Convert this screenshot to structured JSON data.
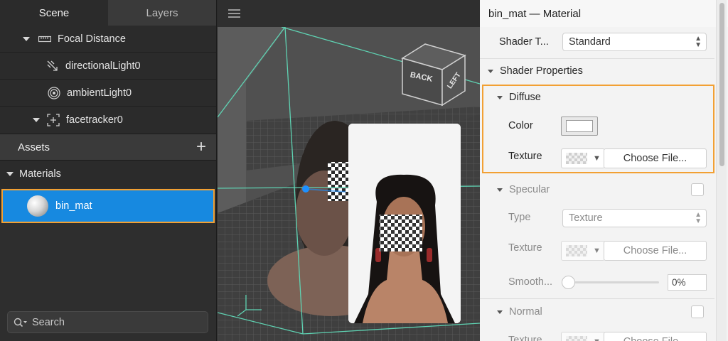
{
  "left_panel": {
    "tabs": [
      {
        "label": "Scene",
        "active": true
      },
      {
        "label": "Layers",
        "active": false
      }
    ],
    "scene_tree": [
      {
        "label": "Focal Distance",
        "icon": "ruler-icon",
        "expanded": true
      },
      {
        "label": "directionalLight0",
        "icon": "directional-light-icon"
      },
      {
        "label": "ambientLight0",
        "icon": "ambient-light-icon"
      },
      {
        "label": "facetracker0",
        "icon": "facetracker-icon",
        "expanded": true
      }
    ],
    "assets": {
      "title": "Assets",
      "add_icon": "plus-icon",
      "group_label": "Materials",
      "selected_item": "bin_mat"
    },
    "search": {
      "placeholder": "Search"
    }
  },
  "viewport": {
    "cube_faces": [
      "BACK",
      "LEFT"
    ],
    "colors": {
      "grid_line": "#5fd3b3",
      "tracker_dot": "#1e90ff"
    }
  },
  "inspector": {
    "title": "bin_mat — Material",
    "shader_type": {
      "label": "Shader T...",
      "value": "Standard"
    },
    "shader_properties": {
      "label": "Shader Properties"
    },
    "diffuse": {
      "label": "Diffuse",
      "color_label": "Color",
      "color_value": "#ffffff",
      "texture_label": "Texture",
      "choose_file": "Choose File..."
    },
    "specular": {
      "label": "Specular",
      "type_label": "Type",
      "type_value": "Texture",
      "texture_label": "Texture",
      "choose_file": "Choose File...",
      "smoothness_label": "Smooth...",
      "smoothness_value": "0%"
    },
    "normal": {
      "label": "Normal",
      "texture_label": "Texture",
      "choose_file": "Choose File..."
    }
  },
  "colors": {
    "accent_highlight": "#f2a033",
    "selection_blue": "#1789e0"
  }
}
